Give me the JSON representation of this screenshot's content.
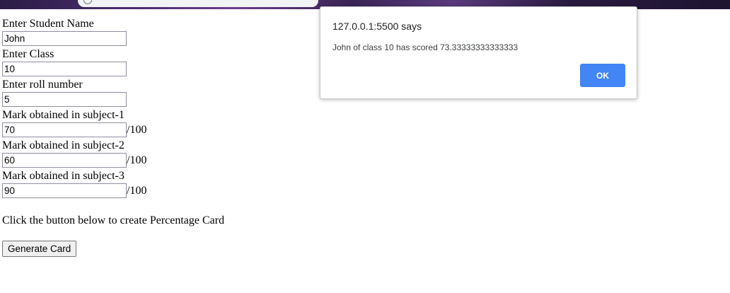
{
  "form": {
    "name_label": "Enter Student Name",
    "name_value": "John",
    "class_label": "Enter Class",
    "class_value": "10",
    "roll_label": "Enter roll number",
    "roll_value": "5",
    "subject1_label": "Mark obtained in subject-1",
    "subject1_value": "70",
    "subject2_label": "Mark obtained in subject-2",
    "subject2_value": "60",
    "subject3_label": "Mark obtained in subject-3",
    "subject3_value": "90",
    "out_of": "/100",
    "hint": "Click the button below to create Percentage Card",
    "button_label": "Generate Card"
  },
  "dialog": {
    "title": "127.0.0.1:5500 says",
    "message": "John of class 10 has scored 73.33333333333333",
    "ok_label": "OK",
    "ok_color": "#4285f4"
  }
}
